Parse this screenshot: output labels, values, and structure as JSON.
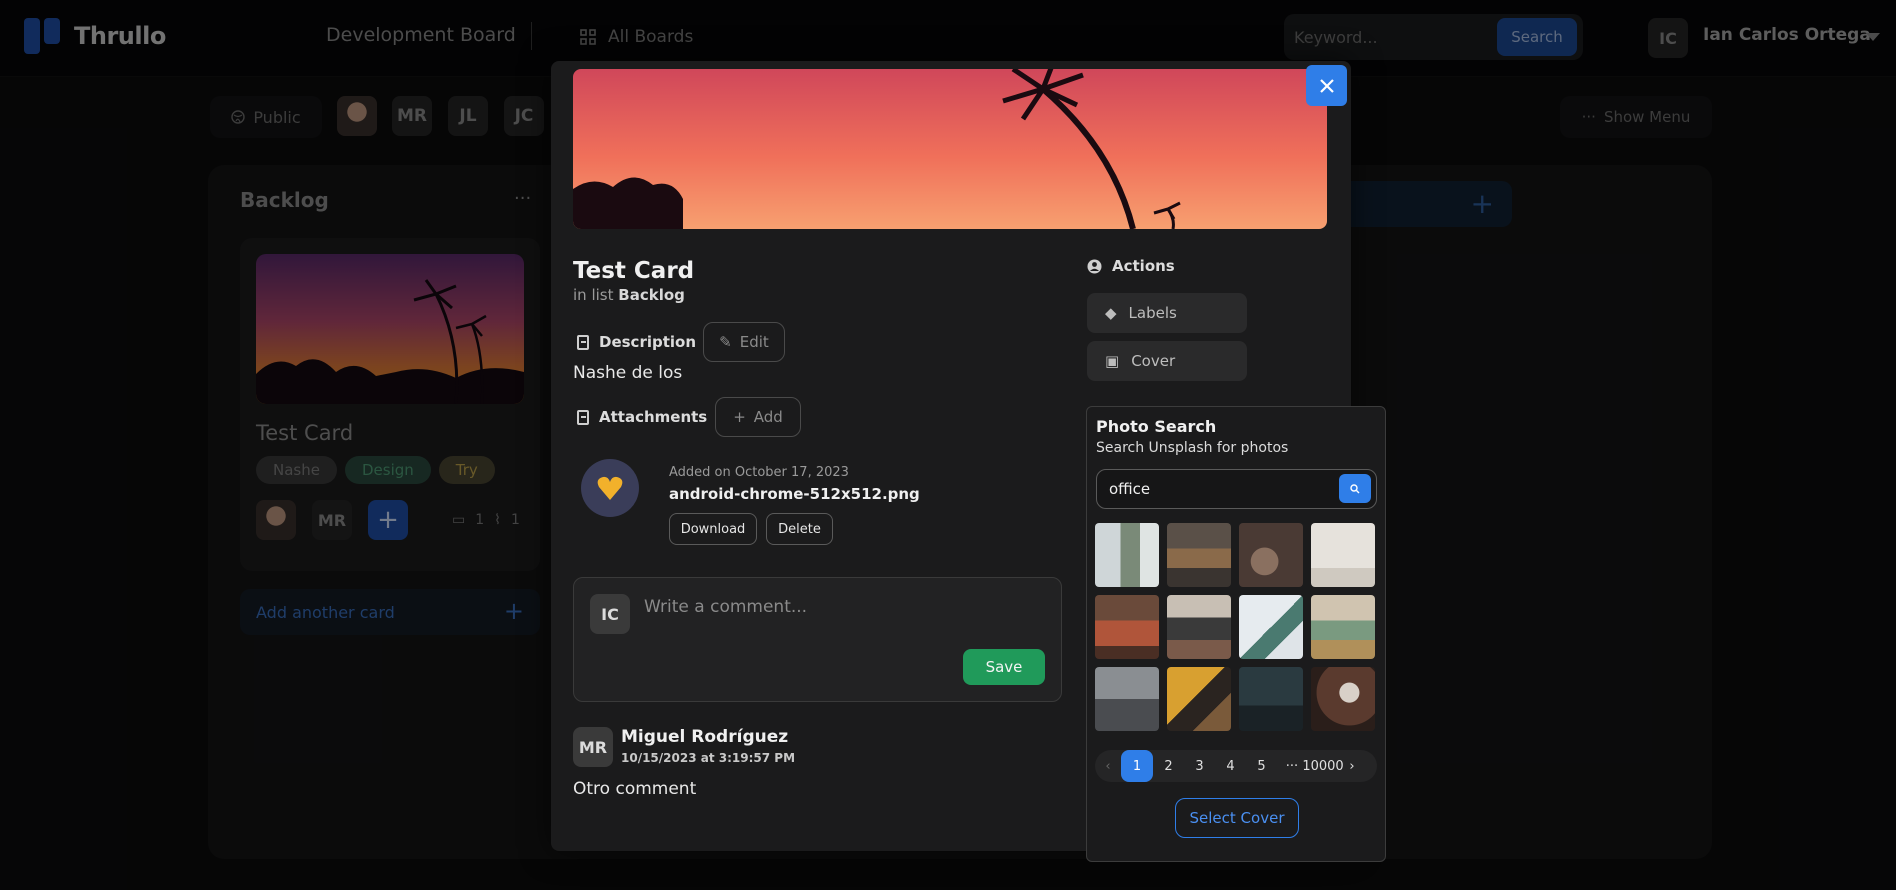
{
  "app": {
    "name": "Thrullo"
  },
  "header": {
    "board_title": "Development Board",
    "all_boards": "All Boards",
    "search_placeholder": "Keyword...",
    "search_button": "Search",
    "user_initials": "IC",
    "user_name": "Ian Carlos Ortega"
  },
  "subbar": {
    "visibility": "Public",
    "members": [
      "MR",
      "JL",
      "JC"
    ],
    "show_menu": "Show Menu"
  },
  "board": {
    "list": {
      "title": "Backlog",
      "menu": "···",
      "card": {
        "title": "Test Card",
        "labels": [
          "Nashe",
          "Design",
          "Try"
        ],
        "member_initials": "MR",
        "comments": "1",
        "attachments": "1"
      },
      "add_card": "Add another card"
    }
  },
  "modal": {
    "title": "Test Card",
    "in_list_prefix": "in list",
    "in_list_name": "Backlog",
    "description_label": "Description",
    "edit_label": "Edit",
    "description_text": "Nashe de los",
    "attachments_label": "Attachments",
    "add_label": "Add",
    "attachment": {
      "added_on": "Added on October 17, 2023",
      "file_name": "android-chrome-512x512.png",
      "download": "Download",
      "delete": "Delete"
    },
    "comment_box": {
      "initials": "IC",
      "placeholder": "Write a comment...",
      "save": "Save"
    },
    "comment": {
      "initials": "MR",
      "author": "Miguel Rodríguez",
      "time": "10/15/2023 at 3:19:57 PM",
      "text": "Otro comment"
    },
    "actions": {
      "heading": "Actions",
      "labels": "Labels",
      "cover": "Cover"
    }
  },
  "photo_search": {
    "title": "Photo Search",
    "subtitle": "Search Unsplash for photos",
    "query": "office",
    "pages": [
      "1",
      "2",
      "3",
      "4",
      "5",
      "···",
      "10000"
    ],
    "prev": "‹",
    "next": "›",
    "select_cover": "Select Cover"
  },
  "colors": {
    "accent": "#2f7ee8",
    "save_green": "#209a5a"
  }
}
